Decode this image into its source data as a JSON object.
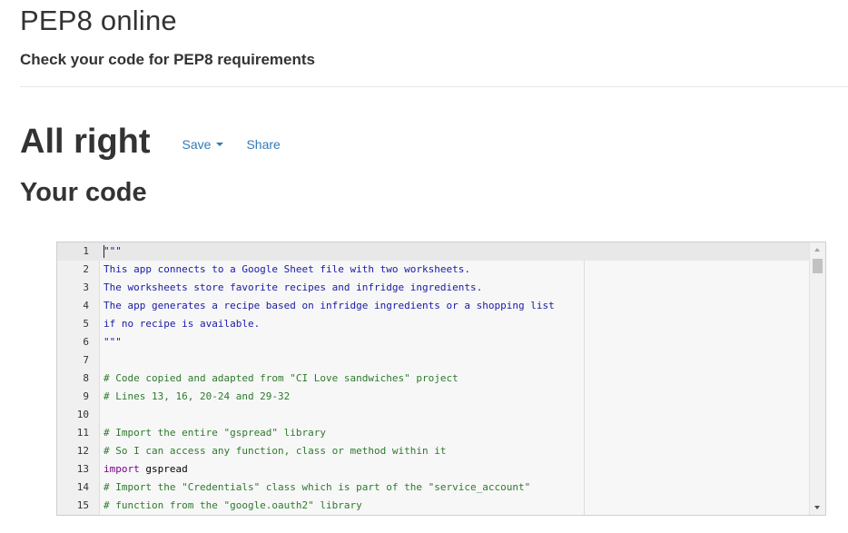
{
  "header": {
    "title": "PEP8 online",
    "subtitle": "Check your code for PEP8 requirements"
  },
  "result": {
    "status": "All right",
    "save_label": "Save",
    "share_label": "Share"
  },
  "code_section": {
    "heading": "Your code"
  },
  "editor": {
    "lines": [
      {
        "number": "1",
        "text": "\"\"\""
      },
      {
        "number": "2",
        "text": "This app connects to a Google Sheet file with two worksheets."
      },
      {
        "number": "3",
        "text": "The worksheets store favorite recipes and infridge ingredients."
      },
      {
        "number": "4",
        "text": "The app generates a recipe based on infridge ingredients or a shopping list"
      },
      {
        "number": "5",
        "text": "if no recipe is available."
      },
      {
        "number": "6",
        "text": "\"\"\""
      },
      {
        "number": "7",
        "text": ""
      },
      {
        "number": "8",
        "text": "# Code copied and adapted from \"CI Love sandwiches\" project"
      },
      {
        "number": "9",
        "text": "# Lines 13, 16, 20-24 and 29-32"
      },
      {
        "number": "10",
        "text": ""
      },
      {
        "number": "11",
        "text": "# Import the entire \"gspread\" library"
      },
      {
        "number": "12",
        "text": "# So I can access any function, class or method within it"
      },
      {
        "number": "13",
        "keyword": "import",
        "name": " gspread"
      },
      {
        "number": "14",
        "text": "# Import the \"Credentials\" class which is part of the \"service_account\""
      },
      {
        "number": "15",
        "text": "# function from the \"google.oauth2\" library"
      }
    ]
  },
  "colors": {
    "link": "#337ab7",
    "string": "#1a1aa6",
    "comment": "#2d7a2d",
    "keyword": "#770088"
  }
}
